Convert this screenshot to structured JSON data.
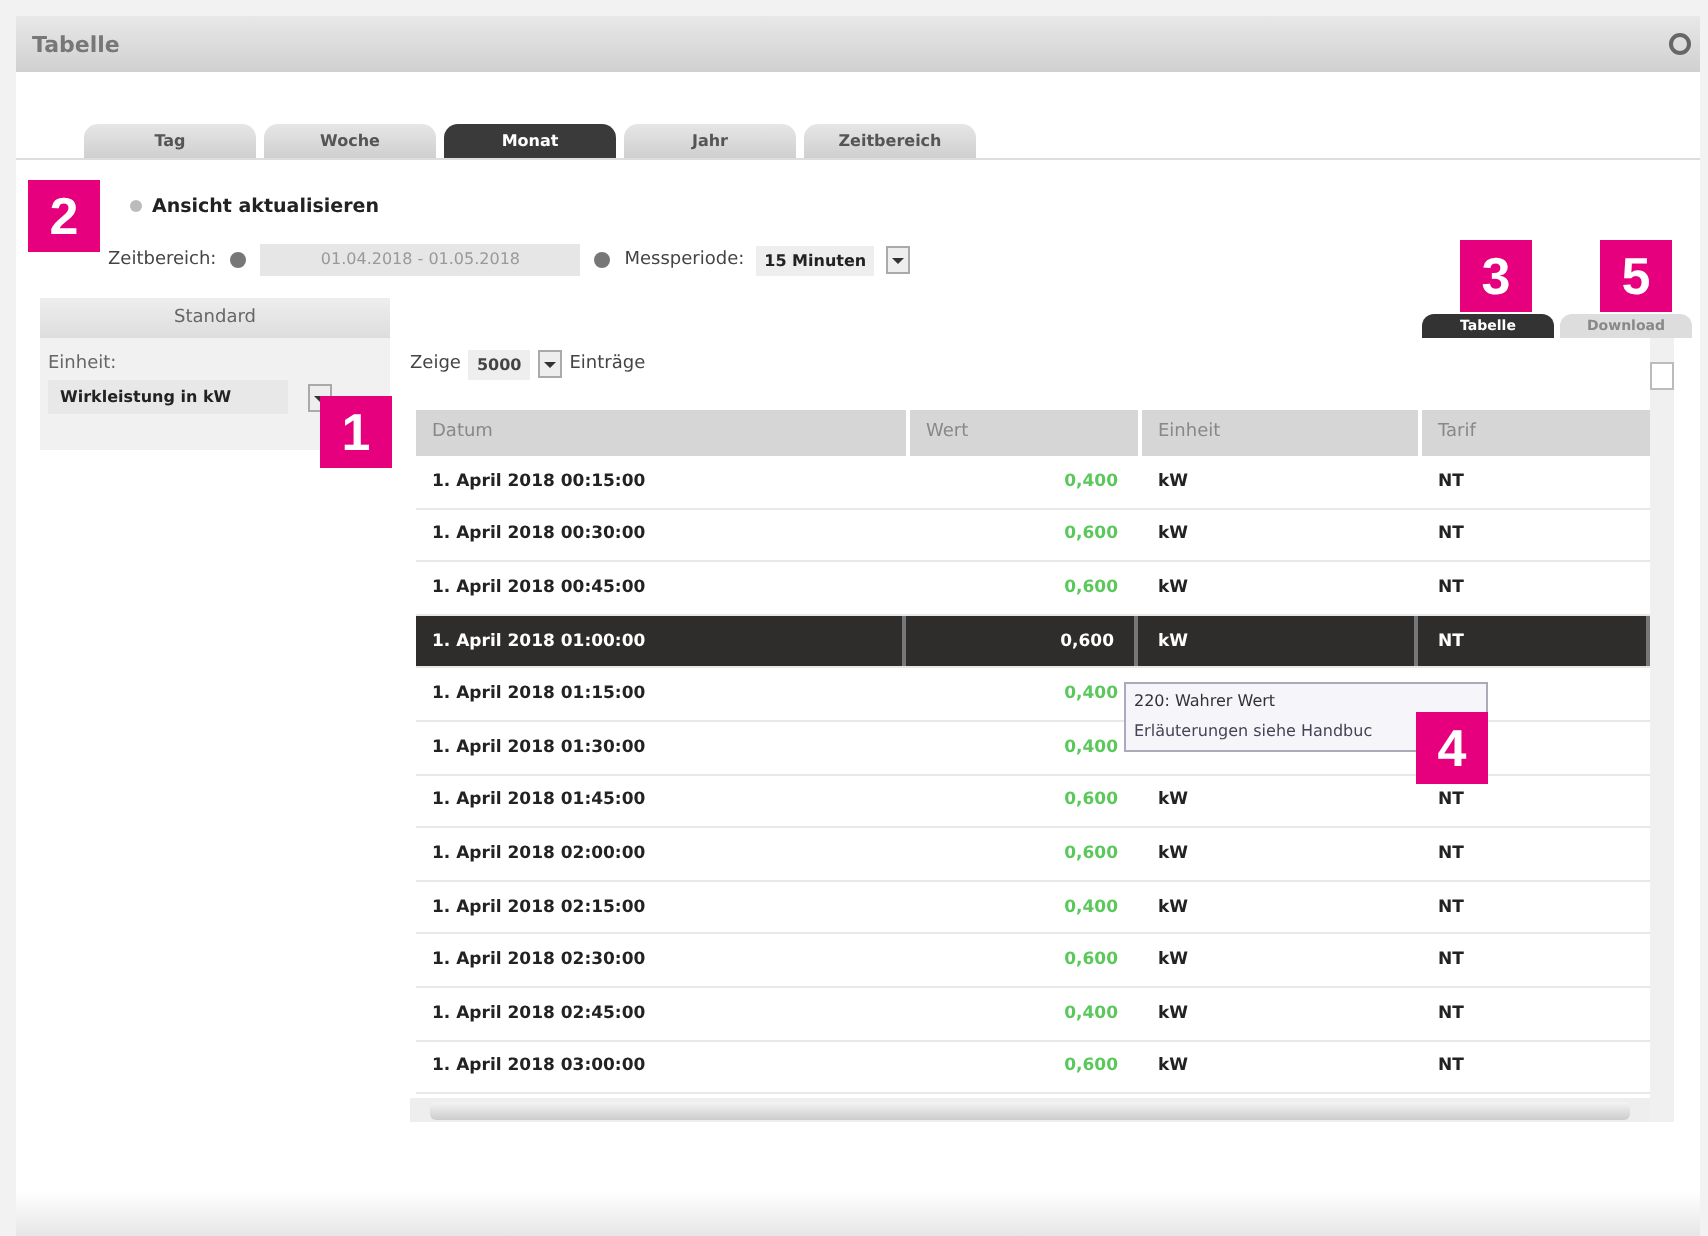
{
  "window": {
    "title": "Tabelle"
  },
  "tabs": [
    {
      "label": "Tag",
      "selected": false
    },
    {
      "label": "Woche",
      "selected": false
    },
    {
      "label": "Monat",
      "selected": true
    },
    {
      "label": "Jahr",
      "selected": false
    },
    {
      "label": "Zeitbereich",
      "selected": false
    }
  ],
  "refresh": {
    "label": "Ansicht aktualisieren"
  },
  "range": {
    "label": "Zeitbereich:",
    "value": "01.04.2018 - 01.05.2018",
    "period_label": "Messperiode:",
    "period": "15 Minuten"
  },
  "sidebar": {
    "header": "Standard",
    "unit_label": "Einheit:",
    "unit": "Wirkleistung in kW"
  },
  "view_tabs": [
    {
      "label": "Tabelle",
      "selected": true
    },
    {
      "label": "Download",
      "selected": false
    }
  ],
  "entries": {
    "prefix": "Zeige",
    "value": "5000",
    "suffix": "Einträge"
  },
  "table": {
    "columns": [
      "Datum",
      "Wert",
      "Einheit",
      "Tarif"
    ],
    "rows": [
      {
        "datum": "1. April 2018 00:15:00",
        "wert": "0,400",
        "einheit": "kW",
        "tarif": "NT",
        "selected": false
      },
      {
        "datum": "1. April 2018 00:30:00",
        "wert": "0,600",
        "einheit": "kW",
        "tarif": "NT",
        "selected": false
      },
      {
        "datum": "1. April 2018 00:45:00",
        "wert": "0,600",
        "einheit": "kW",
        "tarif": "NT",
        "selected": false
      },
      {
        "datum": "1. April 2018 01:00:00",
        "wert": "0,600",
        "einheit": "kW",
        "tarif": "NT",
        "selected": true
      },
      {
        "datum": "1. April 2018 01:15:00",
        "wert": "0,400",
        "selected": false
      },
      {
        "datum": "1. April 2018 01:30:00",
        "wert": "0,400",
        "selected": false
      },
      {
        "datum": "1. April 2018 01:45:00",
        "wert": "0,600",
        "einheit": "kW",
        "tarif": "NT",
        "selected": false
      },
      {
        "datum": "1. April 2018 02:00:00",
        "wert": "0,600",
        "einheit": "kW",
        "tarif": "NT",
        "selected": false
      },
      {
        "datum": "1. April 2018 02:15:00",
        "wert": "0,400",
        "einheit": "kW",
        "tarif": "NT",
        "selected": false
      },
      {
        "datum": "1. April 2018 02:30:00",
        "wert": "0,600",
        "einheit": "kW",
        "tarif": "NT",
        "selected": false
      },
      {
        "datum": "1. April 2018 02:45:00",
        "wert": "0,400",
        "einheit": "kW",
        "tarif": "NT",
        "selected": false
      },
      {
        "datum": "1. April 2018 03:00:00",
        "wert": "0,600",
        "einheit": "kW",
        "tarif": "NT",
        "selected": false
      }
    ]
  },
  "tooltip": {
    "lines": [
      "220: Wahrer Wert",
      "Erläuterungen siehe Handbuc"
    ]
  },
  "markers": [
    {
      "number": "2"
    },
    {
      "number": "1"
    },
    {
      "number": "3"
    },
    {
      "number": "5"
    },
    {
      "number": "4"
    }
  ]
}
